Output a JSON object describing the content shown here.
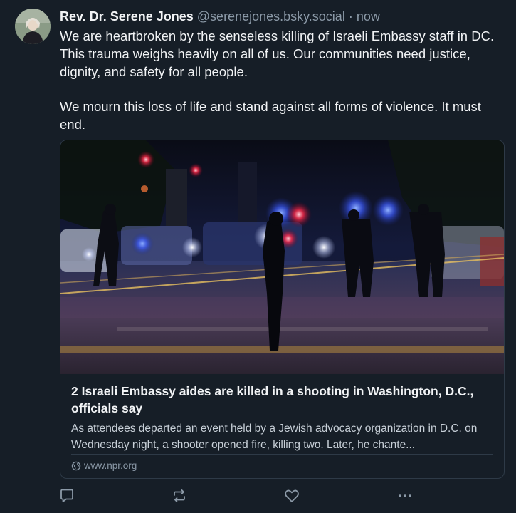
{
  "post": {
    "author_name": "Rev. Dr. Serene Jones",
    "author_handle": "@serenejones.bsky.social",
    "separator": "·",
    "timestamp": "now",
    "paragraphs": [
      "We are heartbroken by the senseless killing of Israeli Embassy staff in DC. This trauma weighs heavily on all of us. Our communities need justice, dignity, and safety for all people.",
      "We mourn this loss of life and stand against all forms of violence. It must end."
    ]
  },
  "link_card": {
    "title": "2 Israeli Embassy aides are killed in a shooting in Washington, D.C., officials say",
    "description": "As attendees departed an event held by a Jewish advocacy organization in D.C. on Wednesday night, a shooter opened fire, killing two. Later, he chante...",
    "domain": "www.npr.org",
    "domain_icon": "globe-icon"
  },
  "actions": {
    "reply_icon": "reply-icon",
    "repost_icon": "repost-icon",
    "like_icon": "heart-icon",
    "more_icon": "more-icon"
  },
  "colors": {
    "background": "#161e27",
    "text_primary": "#f1f3f5",
    "text_secondary": "#8c9aa8",
    "border": "#2e3a47"
  }
}
